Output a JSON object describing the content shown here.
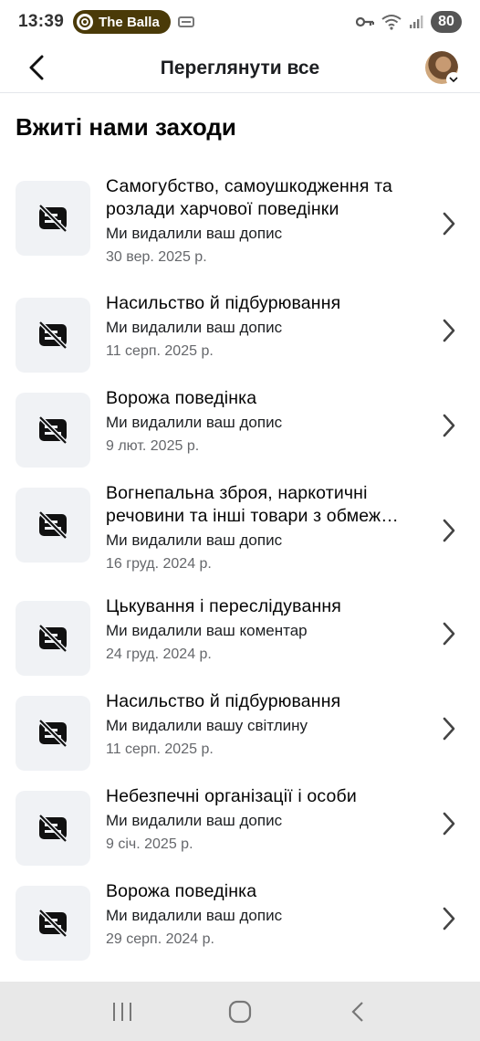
{
  "status_bar": {
    "time": "13:39",
    "media_app": "The Balla",
    "battery": "80"
  },
  "header": {
    "title": "Переглянути все",
    "back_icon": "chevron-left-icon",
    "avatar_icon": "profile-avatar"
  },
  "section": {
    "title": "Вжиті нами заходи"
  },
  "items": [
    {
      "title": "Самогубство, самоушкодження та розлади харчової поведінки",
      "subtitle": "Ми видалили ваш допис",
      "date": "30 вер. 2025 р."
    },
    {
      "title": "Насильство й підбурювання",
      "subtitle": "Ми видалили ваш допис",
      "date": "11 серп. 2025 р."
    },
    {
      "title": "Ворожа поведінка",
      "subtitle": "Ми видалили ваш допис",
      "date": "9 лют. 2025 р."
    },
    {
      "title": "Вогнепальна зброя, наркотичні речовини та інші товари з обмеж…",
      "subtitle": "Ми видалили ваш допис",
      "date": "16 груд. 2024 р."
    },
    {
      "title": "Цькування і переслідування",
      "subtitle": "Ми видалили ваш коментар",
      "date": "24 груд. 2024 р."
    },
    {
      "title": "Насильство й підбурювання",
      "subtitle": "Ми видалили вашу світлину",
      "date": "11 серп. 2025 р."
    },
    {
      "title": "Небезпечні організації і особи",
      "subtitle": "Ми видалили ваш допис",
      "date": "9 січ. 2025 р."
    },
    {
      "title": "Ворожа поведінка",
      "subtitle": "Ми видалили ваш допис",
      "date": "29 серп. 2024 р."
    }
  ],
  "colors": {
    "thumb_bg": "#f0f2f5",
    "secondary_text": "#65676b",
    "media_pill": "#4a3a08"
  }
}
